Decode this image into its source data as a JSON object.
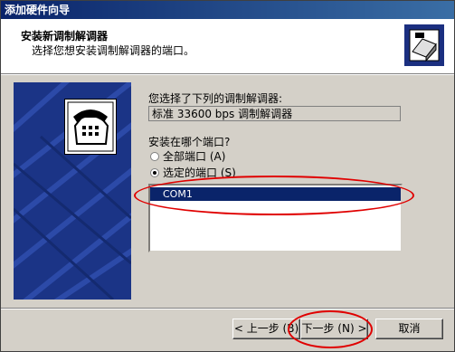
{
  "window": {
    "title": "添加硬件向导"
  },
  "header": {
    "title": "安装新调制解调器",
    "subtitle": "选择您想安装调制解调器的端口。",
    "icon": "modem-install-icon"
  },
  "panel": {
    "icon": "telephone-icon"
  },
  "selected_modem": {
    "label": "您选择了下列的调制解调器:",
    "value": "标准 33600 bps 调制解调器"
  },
  "port_choice": {
    "label": "安装在哪个端口?",
    "options": [
      {
        "label": "全部端口 (A)",
        "selected": false
      },
      {
        "label": "选定的端口 (S)",
        "selected": true
      }
    ]
  },
  "port_list": {
    "items": [
      "COM1"
    ],
    "selected": "COM1"
  },
  "buttons": {
    "back": "< 上一步 (B)",
    "next": "下一步 (N) >",
    "cancel": "取消"
  },
  "annotation_color": "#e00000"
}
